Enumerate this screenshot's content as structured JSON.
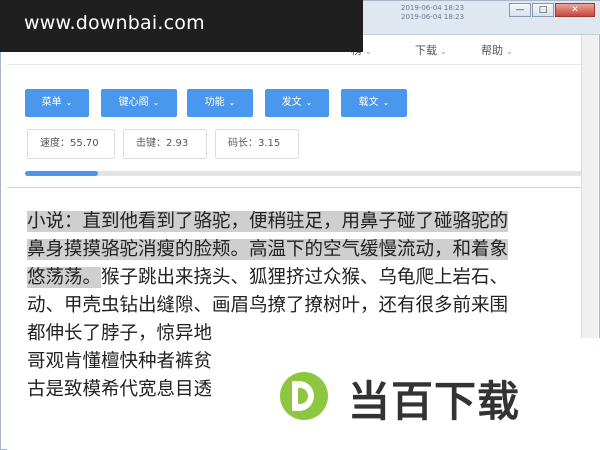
{
  "watermark": {
    "text": "www.downbai.com"
  },
  "window": {
    "title_info_line1": "2019-06-04 18:23",
    "title_info_line2": "2019-06-04 18:23",
    "controls": {
      "minimize": "—",
      "maximize": "□",
      "close": "✕"
    }
  },
  "menubar": {
    "items": [
      {
        "label": "下载"
      },
      {
        "label": "帮助"
      }
    ],
    "partial_left": "…",
    "partial_mid": "榜"
  },
  "toolbar": {
    "buttons": [
      {
        "label": "菜单"
      },
      {
        "label": "键心阁"
      },
      {
        "label": "功能"
      },
      {
        "label": "发文"
      },
      {
        "label": "载文"
      }
    ],
    "stats": [
      {
        "label": "速度：55.70"
      },
      {
        "label": "击键：2.93"
      },
      {
        "label": "码长：3.15"
      }
    ],
    "progress_fraction": 0.13
  },
  "content": {
    "lines": [
      {
        "highlighted": "小说：直到他看到了骆驼，便稍驻足，用鼻子碰了碰骆驼的",
        "rest": ""
      },
      {
        "highlighted": "鼻身摸摸骆驼消瘦的脸颊。高温下的空气缓慢流动，和着象",
        "rest": ""
      },
      {
        "highlighted": "悠荡荡。",
        "rest": "猴子跳出来挠头、狐狸挤过众猴、乌龟爬上岩石、"
      },
      {
        "highlighted": "",
        "rest": "动、甲壳虫钻出缝隙、画眉鸟撩了撩树叶，还有很多前来围"
      },
      {
        "highlighted": "",
        "rest": "都伸长了脖子，惊异地"
      },
      {
        "highlighted": "",
        "rest": "哥观肯懂檀快种者裤贫"
      },
      {
        "highlighted": "",
        "rest": "古是致模希代宽息目透"
      }
    ]
  },
  "logo": {
    "text": "当百下载"
  },
  "colors": {
    "accent": "#4a98ee",
    "highlight": "#cfcfcf",
    "logo_green": "#8dc63f"
  }
}
